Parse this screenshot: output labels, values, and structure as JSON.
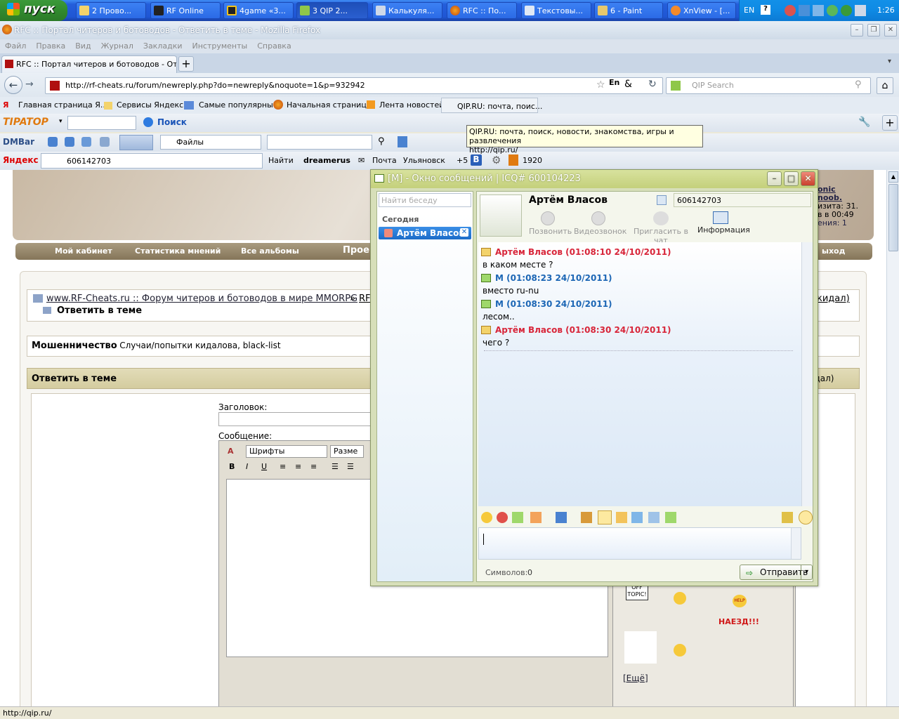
{
  "taskbar": {
    "start_label": "пуск",
    "tasks": [
      {
        "label": "2 Прово..."
      },
      {
        "label": "RF Online"
      },
      {
        "label": "4game «3..."
      },
      {
        "label": "3 QIP 2..."
      },
      {
        "label": "Калькуля..."
      },
      {
        "label": "RFC :: По..."
      },
      {
        "label": "Текстовы..."
      },
      {
        "label": "6 - Paint"
      },
      {
        "label": "XnView - [..."
      }
    ],
    "lang": "EN",
    "time": "1:26"
  },
  "firefox": {
    "window_title": "RFC :: Портал читеров и ботоводов - Ответить в теме - Mozilla Firefox",
    "menu": [
      "Файл",
      "Правка",
      "Вид",
      "Журнал",
      "Закладки",
      "Инструменты",
      "Справка"
    ],
    "tab_title": "RFC :: Портал читеров и ботоводов - Отв...",
    "url": "http://rf-cheats.ru/forum/newreply.php?do=newreply&noquote=1&p=932942",
    "search_placeholder": "QIP Search",
    "bookmarks": [
      "Главная страница Я...",
      "Сервисы Яндекса",
      "Самые популярные",
      "Начальная страница",
      "Лента новостей",
      "QIP.RU: почта, поис..."
    ],
    "tooltip_line1": "QIP.RU: почта, поиск, новости, знакомства, игры и развлечения",
    "tooltip_line2": "http://qip.ru/",
    "toolbar1": {
      "logo": "TIPATOP",
      "search_btn": "Поиск"
    },
    "toolbar2": {
      "logo": "DMBar",
      "files_select": "Файлы"
    },
    "toolbar3": {
      "logo": "Яндекс",
      "query": "606142703",
      "find_btn": "Найти",
      "user": "dreamerus",
      "mail": "Почта",
      "city": "Ульяновск",
      "temp": "+5",
      "count": "1920"
    },
    "status_text": "http://qip.ru/"
  },
  "forum": {
    "nav": [
      "Мой кабинет",
      "Статистика мнений",
      "Все альбомы",
      "Проек",
      "ыход"
    ],
    "user_side": {
      "name": "onic noob.",
      "visit": "изита: 31.",
      "time": "в в 00:49",
      "msgs": "ения: 1"
    },
    "breadcrumb_link": "www.RF-Cheats.ru :: Форум читеров и ботоводов в мире MMORPG",
    "breadcrumb_sep": "»",
    "breadcrumb_rf": "RF",
    "breadcrumb_tail": "кидал)",
    "breadcrumb_current": "Ответить в теме",
    "forum_name": "Мошенничество",
    "forum_desc": "Случаи/попытки кидалова, black-list",
    "reply_header": "Ответить в теме",
    "reply_header_tail": "в-кидал)",
    "title_label": "Заголовок:",
    "message_label": "Сообщение:",
    "font_select": "Шрифты",
    "size_select": "Разме",
    "smilies_more": "[Ещё]",
    "smilie_offtopic": "OFF TOPIC!",
    "smilie_help": "HELP",
    "smilie_naezd": "НАЕЗД!!!",
    "bold": "B",
    "italic": "I",
    "underline": "U"
  },
  "qip": {
    "title": "[M] - Окно сообщений | ICQ# 600104223",
    "search_placeholder": "Найти беседу",
    "group_today": "Сегодня",
    "contact": "Артём Власов",
    "contact_uin": "606142703",
    "actions": [
      "Позвонить",
      "Видеозвонок",
      "Пригласить в чат",
      "Информация"
    ],
    "messages": [
      {
        "header": "Артём Власов (01:08:10 24/10/2011)",
        "text": "в каком месте ?",
        "color": "#d8263a"
      },
      {
        "header": "M (01:08:23 24/10/2011)",
        "text": "вместо ru-nu",
        "color": "#1c66b5"
      },
      {
        "header": "M (01:08:30 24/10/2011)",
        "text": "лесом..",
        "color": "#1c66b5"
      },
      {
        "header": "Артём Власов (01:08:30 24/10/2011)",
        "text": "чего ?",
        "color": "#d8263a"
      }
    ],
    "chars_label": "Символов:",
    "chars_count": "0",
    "send_label": "Отправить"
  }
}
